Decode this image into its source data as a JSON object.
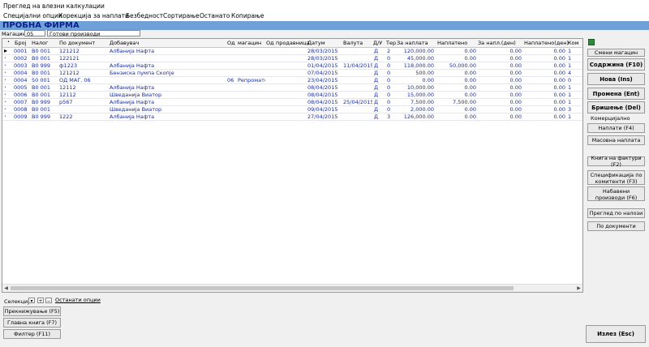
{
  "window_title": "Преглед на влезни калкулации",
  "menu": [
    "Специјални опции",
    "Корекција за наплати",
    "Безбедност",
    "Сортирање",
    "Останато",
    "Копирање"
  ],
  "company_name": "ПРОБНА ФИРМА",
  "warehouse": {
    "label": "Магацин",
    "code": "05",
    "name": "Готови производи"
  },
  "columns": [
    "Број",
    "Налог",
    "По документ",
    "Добавувач",
    "Од",
    "магацин",
    "Од",
    "продавница",
    "Датум",
    "Валута",
    "Д/У",
    "Тер",
    "За наплата",
    "Наплатено",
    "За напл.(ден)",
    "Наплатено(ден)",
    "Ком"
  ],
  "rows": [
    {
      "broj": "0001",
      "nalog": "В0 001",
      "dok": "121212",
      "dobavuvac": "Албанија Нафта",
      "od": "",
      "magacin": "",
      "od2": "",
      "prod": "",
      "datum": "28/03/2015",
      "valuta": "",
      "du": "Д",
      "ter": "2",
      "za_naplata": "120,000.00",
      "naplateno": "0.00",
      "za_napl_den": "0.00",
      "naplateno_den": "0.00",
      "kom": "1"
    },
    {
      "broj": "0002",
      "nalog": "В0 001",
      "dok": "122121",
      "dobavuvac": "",
      "od": "",
      "magacin": "",
      "od2": "",
      "prod": "",
      "datum": "28/03/2015",
      "valuta": "",
      "du": "Д",
      "ter": "0",
      "za_naplata": "45,000.00",
      "naplateno": "0.00",
      "za_napl_den": "0.00",
      "naplateno_den": "0.00",
      "kom": "1"
    },
    {
      "broj": "0003",
      "nalog": "В0 999",
      "dok": "ф1223",
      "dobavuvac": "Албанија Нафта",
      "od": "",
      "magacin": "",
      "od2": "",
      "prod": "",
      "datum": "01/04/2015",
      "valuta": "11/04/2015",
      "du": "Д",
      "ter": "0",
      "za_naplata": "118,000.00",
      "naplateno": "50,000.00",
      "za_napl_den": "0.00",
      "naplateno_den": "0.00",
      "kom": "1"
    },
    {
      "broj": "0004",
      "nalog": "В0 001",
      "dok": "121212",
      "dobavuvac": "Бензиска пумпа Скопје",
      "od": "",
      "magacin": "",
      "od2": "",
      "prod": "",
      "datum": "07/04/2015",
      "valuta": "",
      "du": "Д",
      "ter": "0",
      "za_naplata": "500.00",
      "naplateno": "0.00",
      "za_napl_den": "0.00",
      "naplateno_den": "0.00",
      "kom": "4"
    },
    {
      "broj": "0004",
      "nalog": "50 001",
      "dok": "ОД МАГ. 06",
      "dobavuvac": "",
      "od": "06",
      "magacin": "Репромате",
      "od2": "",
      "prod": "",
      "datum": "23/04/2015",
      "valuta": "",
      "du": "Д",
      "ter": "0",
      "za_naplata": "0.00",
      "naplateno": "0.00",
      "za_napl_den": "0.00",
      "naplateno_den": "0.00",
      "kom": "0"
    },
    {
      "broj": "0005",
      "nalog": "В0 001",
      "dok": "12112",
      "dobavuvac": "Албанија Нафта",
      "od": "",
      "magacin": "",
      "od2": "",
      "prod": "",
      "datum": "08/04/2015",
      "valuta": "",
      "du": "Д",
      "ter": "0",
      "za_naplata": "10,000.00",
      "naplateno": "0.00",
      "za_napl_den": "0.00",
      "naplateno_den": "0.00",
      "kom": "1"
    },
    {
      "broj": "0006",
      "nalog": "В0 001",
      "dok": "12112",
      "dobavuvac": "Шведанија Виатор",
      "od": "",
      "magacin": "",
      "od2": "",
      "prod": "",
      "datum": "08/04/2015",
      "valuta": "",
      "du": "Д",
      "ter": "0",
      "za_naplata": "15,000.00",
      "naplateno": "0.00",
      "za_napl_den": "0.00",
      "naplateno_den": "0.00",
      "kom": "1"
    },
    {
      "broj": "0007",
      "nalog": "В0 999",
      "dok": "р567",
      "dobavuvac": "Албанија Нафта",
      "od": "",
      "magacin": "",
      "od2": "",
      "prod": "",
      "datum": "08/04/2015",
      "valuta": "25/04/2015",
      "du": "Д",
      "ter": "0",
      "za_naplata": "7,500.00",
      "naplateno": "7,500.00",
      "za_napl_den": "0.00",
      "naplateno_den": "0.00",
      "kom": "1"
    },
    {
      "broj": "0008",
      "nalog": "В0 001",
      "dok": "",
      "dobavuvac": "Шведанија Виатор",
      "od": "",
      "magacin": "",
      "od2": "",
      "prod": "",
      "datum": "09/04/2015",
      "valuta": "",
      "du": "Д",
      "ter": "0",
      "za_naplata": "2,000.00",
      "naplateno": "0.00",
      "za_napl_den": "0.00",
      "naplateno_den": "0.00",
      "kom": "3"
    },
    {
      "broj": "0009",
      "nalog": "В0 999",
      "dok": "1222",
      "dobavuvac": "Албанија Нафта",
      "od": "",
      "magacin": "",
      "od2": "",
      "prod": "",
      "datum": "27/04/2015",
      "valuta": "",
      "du": "Д",
      "ter": "3",
      "za_naplata": "126,000.00",
      "naplateno": "0.00",
      "za_napl_den": "0.00",
      "naplateno_den": "0.00",
      "kom": "1"
    }
  ],
  "right_buttons": {
    "change_warehouse": "Смени магацин",
    "content": "Содржина (F10)",
    "new": "Нова (Ins)",
    "edit": "Промена (Ent)",
    "delete": "Бришење (Del)",
    "commercial_label": "Комерцијално",
    "payments": "Наплати (F4)",
    "mass_payment": "Масовна наплата",
    "invoice_book": "Книга на фактури (F2)",
    "spec_by_client": "Спецификација по комитенти (F3)",
    "purchased_products": "Набавени производи (F6)",
    "view_by_orders": "Преглед по налози",
    "by_documents": "По документи"
  },
  "bottom": {
    "selection_label": "Селекција",
    "other_options": "Останати опции",
    "rebooking": "Прекнижување (F5)",
    "main_book": "Главна книга (F7)",
    "filter": "Филтер (F11)",
    "exit": "Излез (Esc)"
  }
}
